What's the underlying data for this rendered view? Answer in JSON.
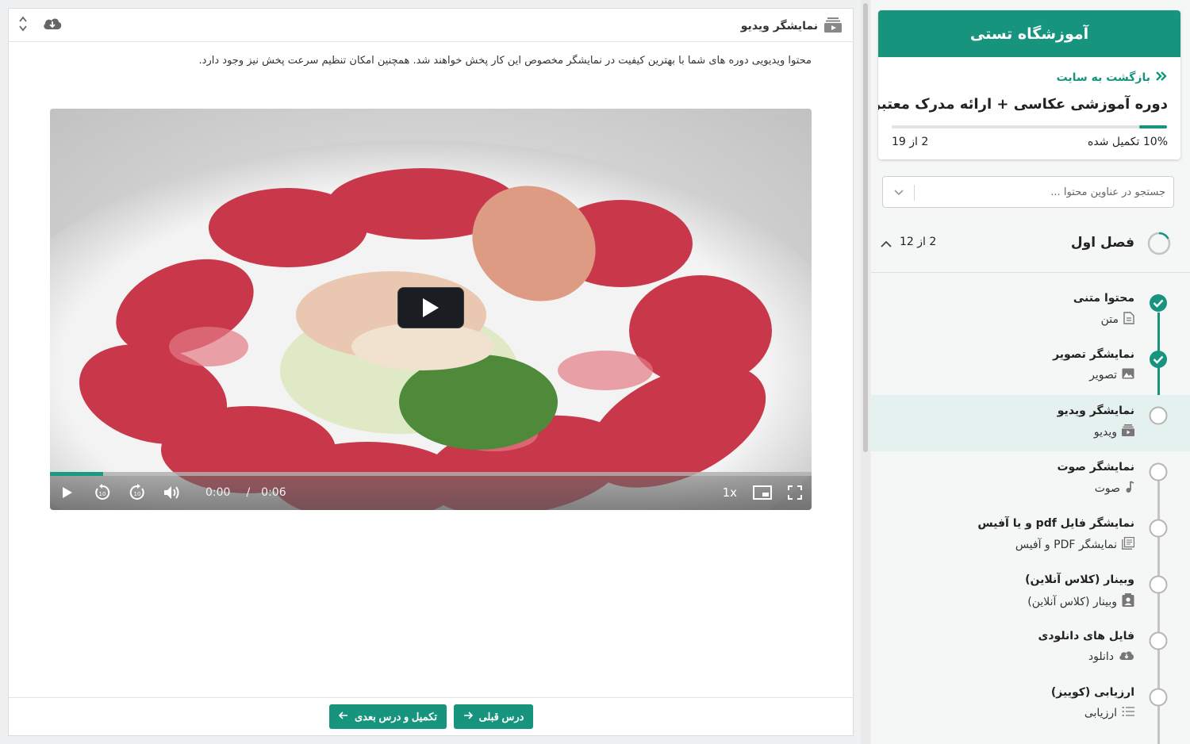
{
  "header": {
    "title": "نمایشگر ویدیو",
    "title_icon": "video-icon",
    "download_icon": "cloud-download-icon",
    "collapse_icon": "chevron-up-down-icon"
  },
  "description": "محتوا ویدیویی دوره های شما با بهترین کیفیت در نمایشگر مخصوص این کار پخش خواهند شد. همچنین امکان تنظیم سرعت پخش نیز وجود دارد.",
  "player": {
    "current_time": "0:00",
    "separator": "/",
    "duration": "0:06",
    "speed": "1x",
    "progress_fraction": 0.07,
    "rewind_icon": "rewind-10-icon",
    "forward_icon": "forward-10-icon"
  },
  "footer": {
    "prev_label": "درس قبلی",
    "next_label": "تکمیل و درس بعدی"
  },
  "sidebar": {
    "school_name": "آموزشگاه تستی",
    "back_label": "بازگشت به سایت",
    "course_title": "دوره آموزشی عکاسی + ارائه مدرک معتبر",
    "progress_label": "10% تکمیل شده",
    "progress_fraction": 0.1,
    "lessons_count": "2 از 19",
    "search_placeholder": "جستجو در عناوین محتوا ...",
    "chapter": {
      "title": "فصل اول",
      "count": "2 از 12",
      "progress_fraction": 0.17
    },
    "lessons": [
      {
        "title": "محتوا متنی",
        "type": "متن",
        "icon": "document-icon",
        "done": true
      },
      {
        "title": "نمایشگر تصویر",
        "type": "تصویر",
        "icon": "image-icon",
        "done": true
      },
      {
        "title": "نمایشگر ویدیو",
        "type": "ویدیو",
        "icon": "video-icon",
        "done": false,
        "active": true
      },
      {
        "title": "نمایشگر صوت",
        "type": "صوت",
        "icon": "music-note-icon",
        "done": false
      },
      {
        "title": "نمایشگر فایل pdf و یا آفیس",
        "type": "نمایشگر PDF و آفیس",
        "icon": "pdf-file-icon",
        "done": false
      },
      {
        "title": "وبینار (کلاس آنلاین)",
        "type": "وبینار (کلاس آنلاین)",
        "icon": "contact-card-icon",
        "done": false
      },
      {
        "title": "فایل های دانلودی",
        "type": "دانلود",
        "icon": "cloud-download-icon",
        "done": false
      },
      {
        "title": "ارزیابی (کوییز)",
        "type": "ارزیابی",
        "icon": "checklist-icon",
        "done": false
      }
    ]
  },
  "colors": {
    "accent": "#16947e",
    "active_row": "#e4f1ee"
  }
}
